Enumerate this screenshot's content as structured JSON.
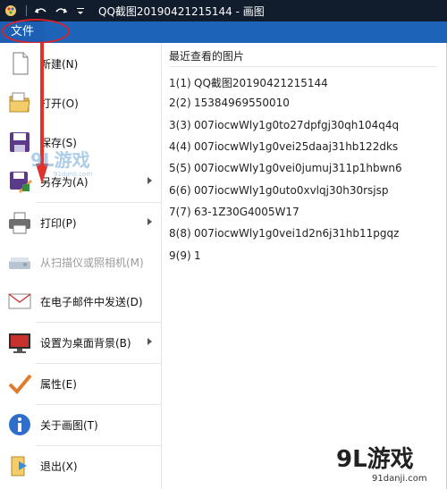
{
  "window": {
    "title": "QQ截图20190421215144 - 画图"
  },
  "menubar": {
    "file_tab": "文件"
  },
  "file_menu": {
    "items": [
      {
        "label": "新建(N)",
        "icon": "new-file-icon",
        "submenu": false,
        "enabled": true
      },
      {
        "label": "打开(O)",
        "icon": "open-folder-icon",
        "submenu": false,
        "enabled": true
      },
      {
        "label": "保存(S)",
        "icon": "save-disk-icon",
        "submenu": false,
        "enabled": true
      },
      {
        "label": "另存为(A)",
        "icon": "save-as-icon",
        "submenu": true,
        "enabled": true
      },
      {
        "label": "打印(P)",
        "icon": "printer-icon",
        "submenu": true,
        "enabled": true
      },
      {
        "label": "从扫描仪或照相机(M)",
        "icon": "scanner-icon",
        "submenu": false,
        "enabled": false
      },
      {
        "label": "在电子邮件中发送(D)",
        "icon": "email-icon",
        "submenu": false,
        "enabled": true
      },
      {
        "label": "设置为桌面背景(B)",
        "icon": "desktop-background-icon",
        "submenu": true,
        "enabled": true
      },
      {
        "label": "属性(E)",
        "icon": "checkmark-icon",
        "submenu": false,
        "enabled": true
      },
      {
        "label": "关于画图(T)",
        "icon": "info-icon",
        "submenu": false,
        "enabled": true
      },
      {
        "label": "退出(X)",
        "icon": "exit-icon",
        "submenu": false,
        "enabled": true
      }
    ]
  },
  "recent": {
    "title": "最近查看的图片",
    "items": [
      {
        "num": "1(1)",
        "name": "QQ截图20190421215144"
      },
      {
        "num": "2(2)",
        "name": "15384969550010"
      },
      {
        "num": "3(3)",
        "name": "007iocwWly1g0to27dpfgj30qh104q4q"
      },
      {
        "num": "4(4)",
        "name": "007iocwWly1g0vei25daaj31hb122dks"
      },
      {
        "num": "5(5)",
        "name": "007iocwWly1g0vei0jumuj311p1hbwn6"
      },
      {
        "num": "6(6)",
        "name": "007iocwWly1g0uto0xvlqj30h30rsjsp"
      },
      {
        "num": "7(7)",
        "name": "63-1Z30G4005W17"
      },
      {
        "num": "8(8)",
        "name": "007iocwWly1g0vei1d2n6j31hb11pgqz"
      },
      {
        "num": "9(9)",
        "name": "1"
      }
    ]
  },
  "watermark": {
    "brand": "9L游戏",
    "url": "91danji.com"
  },
  "colors": {
    "titlebar": "#111c2c",
    "menubar": "#1d63b8",
    "highlight": "#d9232a"
  }
}
